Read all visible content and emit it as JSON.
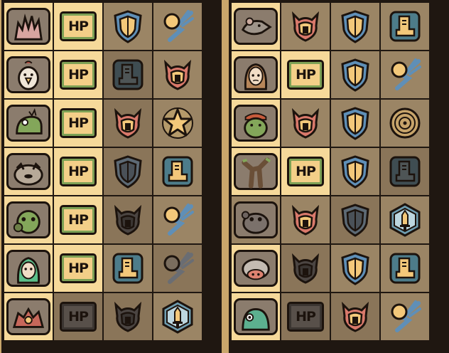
{
  "hp_label": "HP",
  "colors": {
    "background": "#c9a66b",
    "panel": "#1f1711",
    "slot_highlight": "#f6d99a",
    "slot_dark": "#8a7559",
    "shield_blue": "#5f8fb7",
    "icon_gold": "#f3c87a",
    "helm_red": "#d9796b",
    "boot_teal": "#4d7c8a",
    "inactive_gray": "#58504a"
  },
  "panels": [
    {
      "id": "left-team",
      "rows": [
        {
          "character": "spiky-creature",
          "highlighted": true,
          "slots": [
            "hp-active",
            "shield",
            "comet"
          ]
        },
        {
          "character": "chicken",
          "highlighted": true,
          "slots": [
            "hp-active",
            "boot-dim",
            "helmet"
          ]
        },
        {
          "character": "green-lizard",
          "highlighted": true,
          "slots": [
            "hp-active",
            "helmet",
            "star"
          ]
        },
        {
          "character": "bulldog",
          "highlighted": true,
          "slots": [
            "hp-active",
            "shield-dim",
            "boot"
          ]
        },
        {
          "character": "green-golem",
          "highlighted": true,
          "slots": [
            "hp-active",
            "helmet-dim",
            "comet"
          ]
        },
        {
          "character": "elf-girl",
          "highlighted": true,
          "slots": [
            "hp-active",
            "boot",
            "comet-dim"
          ]
        },
        {
          "character": "red-dragon",
          "highlighted": true,
          "slots": [
            "hp-inactive",
            "helmet-dim",
            "sword-card"
          ]
        }
      ]
    },
    {
      "id": "right-team",
      "rows": [
        {
          "character": "rat",
          "highlighted": true,
          "slots": [
            "helmet",
            "shield",
            "boot"
          ]
        },
        {
          "character": "sad-girl",
          "highlighted": true,
          "slots": [
            "hp-active",
            "shield",
            "comet"
          ]
        },
        {
          "character": "pirate-ogre",
          "highlighted": true,
          "slots": [
            "helmet",
            "shield",
            "coin"
          ]
        },
        {
          "character": "tree-ent",
          "highlighted": true,
          "slots": [
            "hp-active",
            "shield",
            "boot-dim"
          ]
        },
        {
          "character": "stone-golem",
          "highlighted": false,
          "slots": [
            "helmet",
            "shield-dim",
            "sword-card"
          ]
        },
        {
          "character": "pig-beast",
          "highlighted": true,
          "slots": [
            "helmet-dim",
            "shield",
            "boot"
          ]
        },
        {
          "character": "green-slime",
          "highlighted": true,
          "slots": [
            "hp-inactive",
            "helmet",
            "comet"
          ]
        }
      ]
    }
  ]
}
